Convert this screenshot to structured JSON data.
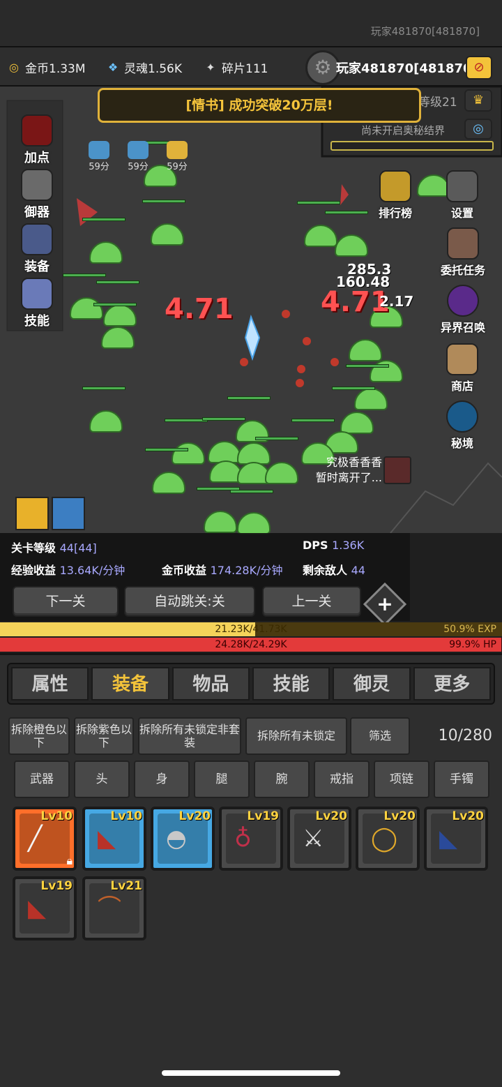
{
  "top": {
    "player_label": "玩家481870[481870]"
  },
  "resources": {
    "gold": "金币1.33M",
    "soul": "灵魂1.56K",
    "shard": "碎片111",
    "player": "玩家481870[481870]"
  },
  "banner": "[情书] 成功突破20万层!",
  "level_badge": "等级21",
  "realm": "尚未开启奥秘结界",
  "left_menu": [
    {
      "label": "加点",
      "icon": "blood-drop-icon"
    },
    {
      "label": "御器",
      "icon": "sword-icon"
    },
    {
      "label": "装备",
      "icon": "shield-icon"
    },
    {
      "label": "技能",
      "icon": "scroll-icon"
    }
  ],
  "right_menu": [
    {
      "label": "排行榜",
      "icon": "trophy-icon"
    },
    {
      "label": "设置",
      "icon": "gear-icon"
    },
    {
      "label": "委托任务",
      "icon": "quest-icon"
    },
    {
      "label": "异界召唤",
      "icon": "portal-icon"
    },
    {
      "label": "商店",
      "icon": "shop-icon"
    },
    {
      "label": "秘境",
      "icon": "secret-realm-icon"
    }
  ],
  "buffs": [
    "59分",
    "59分",
    "59分"
  ],
  "damage": {
    "big1": "4.71",
    "big2": "4.71",
    "small1": "285.3",
    "small2": "160.48",
    "small3": "2.17"
  },
  "chat": {
    "line1": "究极香香香",
    "line2": "暂时离开了..."
  },
  "stats": {
    "stage_label": "关卡等级",
    "stage_value": "44[44]",
    "dps_label": "DPS",
    "dps_value": "1.36K",
    "exp_label": "经验收益",
    "exp_value": "13.64K/分钟",
    "gold_label": "金币收益",
    "gold_value": "174.28K/分钟",
    "enemy_label": "剩余敌人",
    "enemy_value": "44"
  },
  "buttons": {
    "next": "下一关",
    "auto": "自动跳关:关",
    "prev": "上一关"
  },
  "exp_bar": {
    "text": "21.23K/41.73K",
    "pct_text": "50.9% EXP",
    "fraction": 0.509
  },
  "hp_bar": {
    "text": "24.28K/24.29K",
    "pct_text": "99.9% HP",
    "fraction": 0.999
  },
  "tabs": [
    "属性",
    "装备",
    "物品",
    "技能",
    "御灵",
    "更多"
  ],
  "actions": {
    "dismantle_orange": "拆除橙色以下",
    "dismantle_purple": "拆除紫色以下",
    "dismantle_nonset": "拆除所有未锁定非套装",
    "dismantle_unlocked": "拆除所有未锁定",
    "filter": "筛选",
    "capacity": "10/280"
  },
  "filters": [
    "武器",
    "头",
    "身",
    "腿",
    "腕",
    "戒指",
    "项链",
    "手镯"
  ],
  "items": [
    {
      "lv": "Lv10",
      "rarity": "orange",
      "icon": "staff-icon",
      "locked": true
    },
    {
      "lv": "Lv10",
      "rarity": "blue",
      "icon": "boots-icon"
    },
    {
      "lv": "Lv20",
      "rarity": "blue",
      "icon": "helmet-icon"
    },
    {
      "lv": "Lv19",
      "rarity": "gray",
      "icon": "necklace-icon"
    },
    {
      "lv": "Lv20",
      "rarity": "gray",
      "icon": "sword-icon"
    },
    {
      "lv": "Lv20",
      "rarity": "gray",
      "icon": "ring-icon"
    },
    {
      "lv": "Lv20",
      "rarity": "gray",
      "icon": "boots-icon"
    },
    {
      "lv": "Lv19",
      "rarity": "gray",
      "icon": "boots-icon"
    },
    {
      "lv": "Lv21",
      "rarity": "gray",
      "icon": "bracelet-icon"
    }
  ]
}
